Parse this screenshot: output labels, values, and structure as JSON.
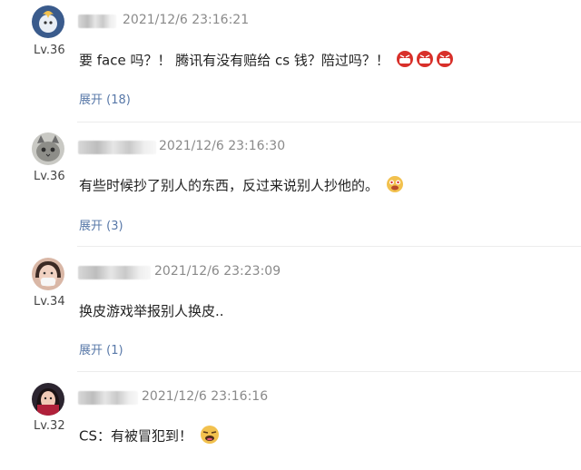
{
  "comments": [
    {
      "level": "Lv.36",
      "time": "2021/12/6 23:16:21",
      "text": "要 face 吗？！ 腾讯有没有赔给 cs 钱？陪过吗？！",
      "expand": "展开 (18)",
      "avatar_icon": "bird-avatar-icon",
      "emoji_icon": "angry-face-icon"
    },
    {
      "level": "Lv.36",
      "time": "2021/12/6 23:16:30",
      "text": "有些时候抄了别人的东西，反过来说别人抄他的。",
      "expand": "展开 (3)",
      "avatar_icon": "cat-avatar-icon",
      "emoji_icon": "drool-face-icon"
    },
    {
      "level": "Lv.34",
      "time": "2021/12/6 23:23:09",
      "text": "换皮游戏举报别人换皮..",
      "expand": "展开 (1)",
      "avatar_icon": "person-avatar-icon",
      "emoji_icon": ""
    },
    {
      "level": "Lv.32",
      "time": "2021/12/6 23:16:16",
      "text": "CS：有被冒犯到！",
      "expand": "",
      "avatar_icon": "girl-avatar-icon",
      "emoji_icon": "annoyed-face-icon"
    }
  ],
  "colors": {
    "expand_link": "#5878a8",
    "timestamp": "#8a8a8a",
    "emoji_red": "#d8302a"
  }
}
